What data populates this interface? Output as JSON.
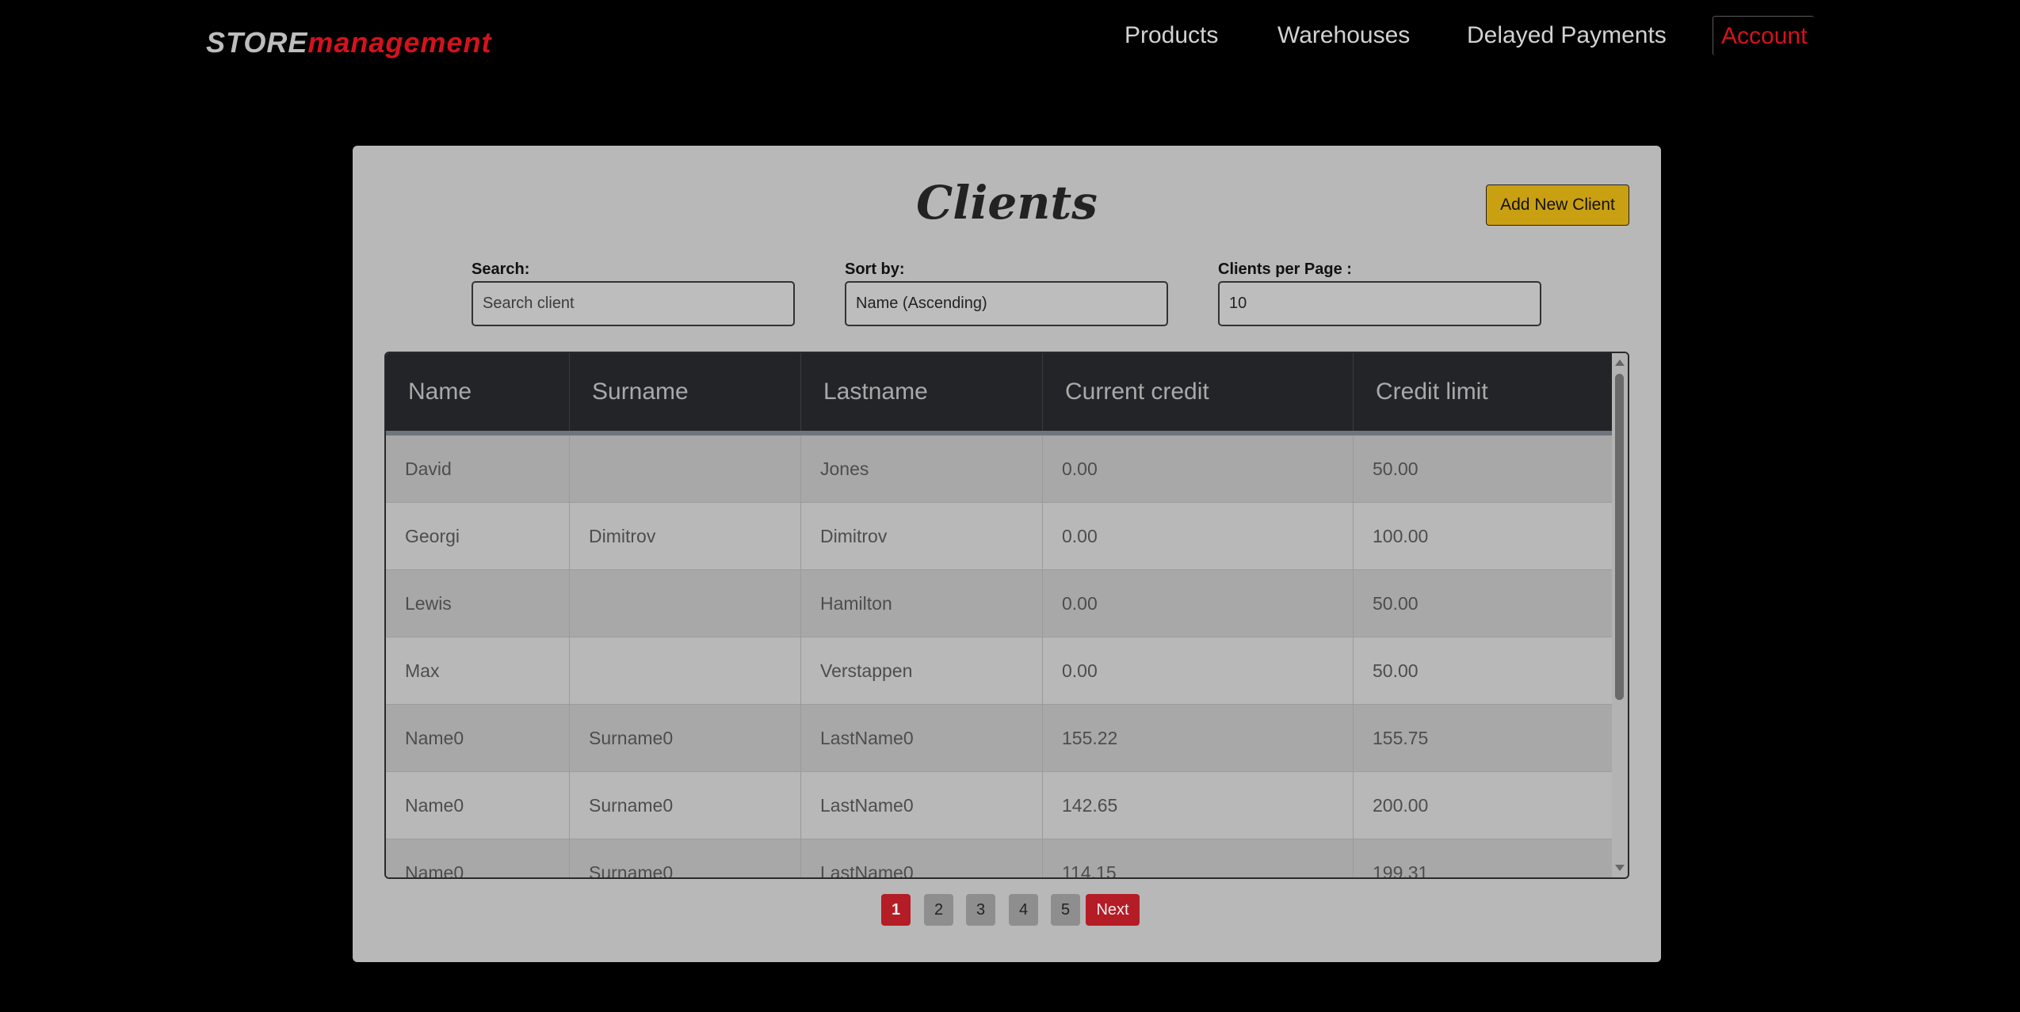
{
  "brand": {
    "part1": "STORE",
    "part2": "management"
  },
  "nav": {
    "products": "Products",
    "warehouses": "Warehouses",
    "delayed_payments": "Delayed Payments",
    "account": "Account"
  },
  "page": {
    "title": "Clients",
    "add_button": "Add New Client"
  },
  "filters": {
    "search": {
      "label": "Search:",
      "placeholder": "Search client",
      "value": ""
    },
    "sort": {
      "label": "Sort by:",
      "value": "Name (Ascending)"
    },
    "per_page": {
      "label": "Clients per Page :",
      "value": "10"
    }
  },
  "table": {
    "columns": [
      "Name",
      "Surname",
      "Lastname",
      "Current credit",
      "Credit limit"
    ],
    "rows": [
      [
        "David",
        "",
        "Jones",
        "0.00",
        "50.00"
      ],
      [
        "Georgi",
        "Dimitrov",
        "Dimitrov",
        "0.00",
        "100.00"
      ],
      [
        "Lewis",
        "",
        "Hamilton",
        "0.00",
        "50.00"
      ],
      [
        "Max",
        "",
        "Verstappen",
        "0.00",
        "50.00"
      ],
      [
        "Name0",
        "Surname0",
        "LastName0",
        "155.22",
        "155.75"
      ],
      [
        "Name0",
        "Surname0",
        "LastName0",
        "142.65",
        "200.00"
      ],
      [
        "Name0",
        "Surname0",
        "LastName0",
        "114.15",
        "199.31"
      ]
    ]
  },
  "pagination": {
    "pages": [
      "1",
      "2",
      "3",
      "4",
      "5"
    ],
    "active": "1",
    "next": "Next"
  },
  "colors": {
    "background": "#000000",
    "card": "#b8b8b8",
    "accent_red": "#b41c26",
    "brand_red": "#d4121e",
    "add_button": "#c9a012",
    "table_header": "#232427"
  }
}
